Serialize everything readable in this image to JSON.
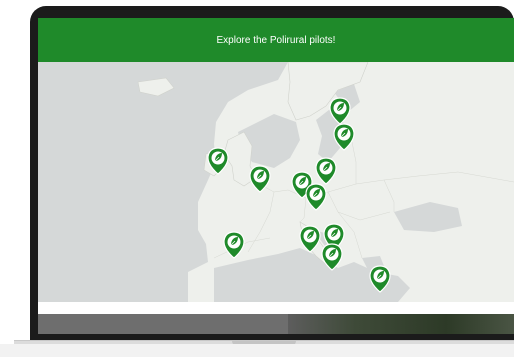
{
  "banner": {
    "title": "Explore the Polirural pilots!"
  },
  "map": {
    "pin_icon": "leaf-pin-icon",
    "pin_color": "#1f8a2a",
    "water_color": "#d5d8d8",
    "land_color": "#eef0ec"
  },
  "colors": {
    "accent": "#1f8a2a",
    "bezel": "#1b1b1b"
  }
}
